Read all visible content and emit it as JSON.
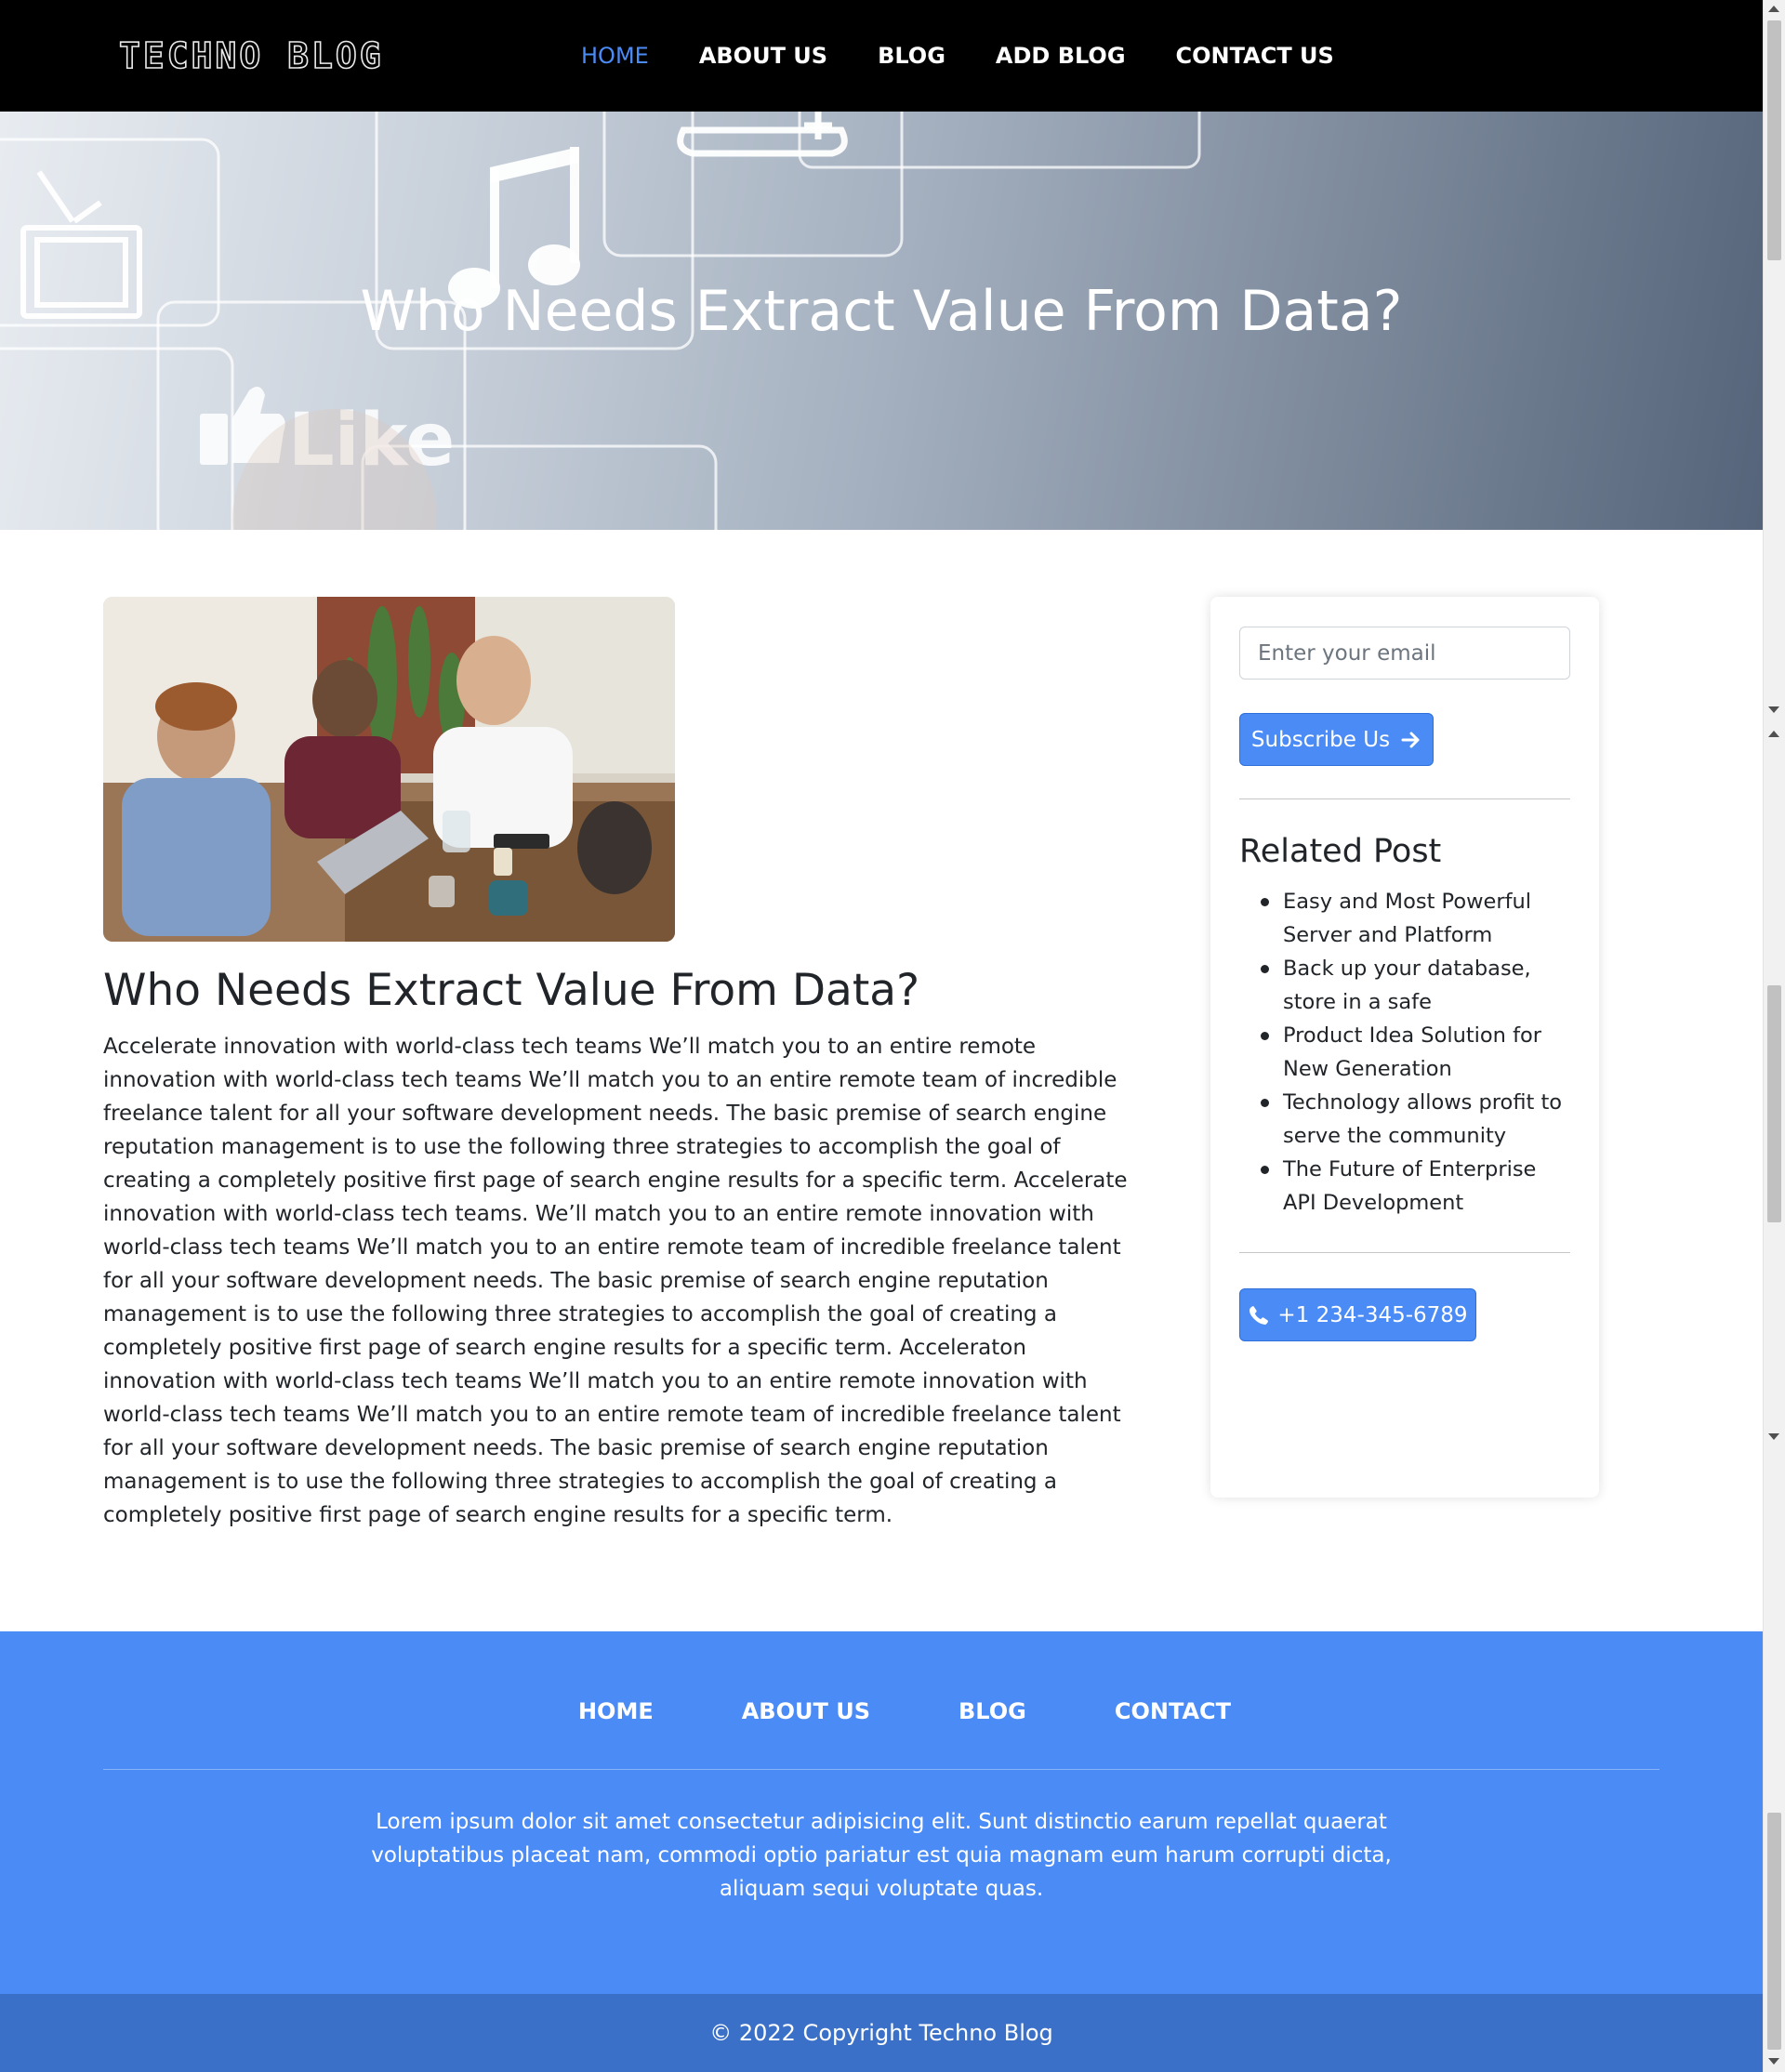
{
  "navbar": {
    "logo": "TECHNO BLOG",
    "links": [
      "HOME",
      "ABOUT US",
      "BLOG",
      "ADD BLOG",
      "CONTACT US"
    ],
    "active": "HOME"
  },
  "hero": {
    "title": "Who Needs Extract Value From Data?",
    "like_text": "Like"
  },
  "article": {
    "title": "Who Needs Extract Value From Data?",
    "body": "Accelerate innovation with world-class tech teams We’ll match you to an entire remote innovation with world-class tech teams We’ll match you to an entire remote team of incredible freelance talent for all your software development needs. The basic premise of search engine reputation management is to use the following three strategies to accomplish the goal of creating a completely positive first page of search engine results for a specific term. Accelerate innovation with world-class tech teams. We’ll match you to an entire remote innovation with world-class tech teams We’ll match you to an entire remote team of incredible freelance talent for all your software development needs. The basic premise of search engine reputation management is to use the following three strategies to accomplish the goal of creating a completely positive first page of search engine results for a specific term. Acceleraton innovation with world-class tech teams We’ll match you to an entire remote innovation with world-class tech teams We’ll match you to an entire remote team of incredible freelance talent for all your software development needs. The basic premise of search engine reputation management is to use the following three strategies to accomplish the goal of creating a completely positive first page of search engine results for a specific term."
  },
  "sidebar": {
    "email_placeholder": "Enter your email",
    "subscribe_label": "Subscribe Us",
    "related_title": "Related Post",
    "related_posts": [
      "Easy and Most Powerful Server and Platform",
      "Back up your database, store in a safe",
      "Product Idea Solution for New Generation",
      "Technology allows profit to serve the community",
      "The Future of Enterprise API Development"
    ],
    "phone_label": "+1 234-345-6789"
  },
  "footer": {
    "links": [
      "HOME",
      "ABOUT US",
      "BLOG",
      "CONTACT"
    ],
    "text": "Lorem ipsum dolor sit amet consectetur adipisicing elit. Sunt distinctio earum repellat quaerat voluptatibus placeat nam, commodi optio pariatur est quia magnam eum harum corrupti dicta, aliquam sequi voluptate quas.",
    "copyright": "© 2022 Copyright Techno Blog"
  },
  "colors": {
    "accent": "#4a8bf5",
    "navbar_bg": "#000000",
    "copyright_bg": "#3a70c7"
  },
  "icons": [
    "arrow-right-icon",
    "phone-icon"
  ]
}
